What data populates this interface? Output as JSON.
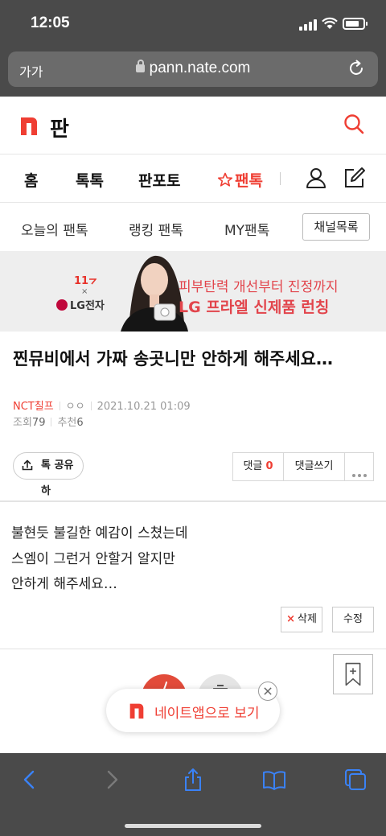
{
  "status_bar": {
    "time": "12:05"
  },
  "url_bar": {
    "text_size_label": "가가",
    "url": "pann.nate.com"
  },
  "header": {
    "logo_text": "판"
  },
  "main_nav": {
    "items": [
      "홈",
      "톡톡",
      "판포토",
      "팬톡"
    ],
    "active_index": 3
  },
  "sub_nav": {
    "items": [
      "오늘의 팬톡",
      "랭킹 팬톡",
      "MY팬톡"
    ],
    "channel_list_label": "채널목록"
  },
  "ad": {
    "brand_11st": "11",
    "brand_x": "×",
    "brand_lg": "LG전자",
    "headline": "피부탄력 개선부터 진정까지",
    "subheadline": "LG 프라엘 신제품 런칭"
  },
  "post": {
    "title": "찐뮤비에서 가짜 송곳니만 안하게 해주세요…",
    "author": "NCT칠프",
    "author_extra": "ㅇㅇ",
    "date": "2021.10.21 01:09",
    "views_label": "조회",
    "views": "79",
    "recommend_label": "추천",
    "recommend": "6",
    "share_label": "톡 공유하",
    "comments_label": "댓글",
    "comments_count": "0",
    "write_comment_label": "댓글쓰기",
    "body_lines": [
      "불현듯 불길한 예감이 스쳤는데",
      "스엠이 그런거 안할거 알지만",
      "안하게 해주세요…"
    ],
    "delete_label": "삭제",
    "edit_label": "수정"
  },
  "app_banner": {
    "text": "네이트앱으로 보기"
  },
  "colors": {
    "accent": "#ef3e33",
    "chrome": "#4a4a4a",
    "toolbar_icon": "#3a82f7"
  }
}
